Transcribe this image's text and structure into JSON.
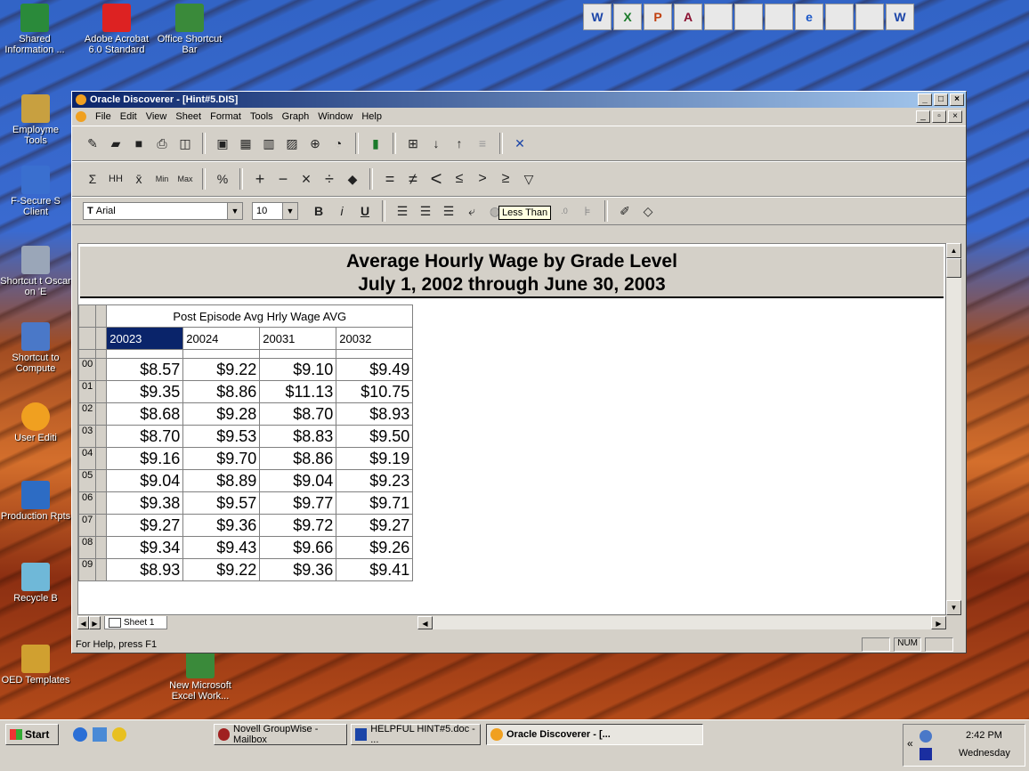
{
  "desktop": {
    "icons": [
      {
        "label": "Shared Information ..."
      },
      {
        "label": "Adobe Acrobat 6.0 Standard"
      },
      {
        "label": "Office Shortcut Bar"
      },
      {
        "label": "Employme Tools"
      },
      {
        "label": "F-Secure S Client"
      },
      {
        "label": "Shortcut t Oscar on 'E"
      },
      {
        "label": "Shortcut to Compute"
      },
      {
        "label": "User Editi"
      },
      {
        "label": "Production Rpts"
      },
      {
        "label": "Recycle B"
      },
      {
        "label": "OED Templates"
      },
      {
        "label": "New Microsoft Excel Work..."
      }
    ],
    "office_bar": [
      "W",
      "X",
      "P",
      "A",
      "",
      "",
      "",
      "e",
      "",
      "",
      "W"
    ]
  },
  "window": {
    "title": "Oracle Discoverer - [Hint#5.DIS]",
    "menu": [
      "File",
      "Edit",
      "View",
      "Sheet",
      "Format",
      "Tools",
      "Graph",
      "Window",
      "Help"
    ],
    "calc_toolbar": {
      "sum": "Σ",
      "count": "HH",
      "avg": "x̄",
      "min": "Min",
      "max": "Max",
      "percent": "%",
      "plus": "+",
      "minus": "−",
      "times": "×",
      "divide": "÷",
      "eq": "=",
      "ne": "≠",
      "lt": "<",
      "le": "≤",
      "gt": ">",
      "ge": "≥"
    },
    "font_name": "Arial",
    "font_size": "10",
    "tooltip": "Less Than",
    "report": {
      "title_line1": "Average Hourly Wage by Grade Level",
      "title_line2": "July 1, 2002 through June 30, 2003",
      "measure_header": "Post Episode Avg Hrly Wage AVG",
      "columns": [
        "20023",
        "20024",
        "20031",
        "20032"
      ],
      "rows": [
        {
          "label": "00",
          "values": [
            "$8.57",
            "$9.22",
            "$9.10",
            "$9.49"
          ]
        },
        {
          "label": "01",
          "values": [
            "$9.35",
            "$8.86",
            "$11.13",
            "$10.75"
          ]
        },
        {
          "label": "02",
          "values": [
            "$8.68",
            "$9.28",
            "$8.70",
            "$8.93"
          ]
        },
        {
          "label": "03",
          "values": [
            "$8.70",
            "$9.53",
            "$8.83",
            "$9.50"
          ]
        },
        {
          "label": "04",
          "values": [
            "$9.16",
            "$9.70",
            "$8.86",
            "$9.19"
          ]
        },
        {
          "label": "05",
          "values": [
            "$9.04",
            "$8.89",
            "$9.04",
            "$9.23"
          ]
        },
        {
          "label": "06",
          "values": [
            "$9.38",
            "$9.57",
            "$9.77",
            "$9.71"
          ]
        },
        {
          "label": "07",
          "values": [
            "$9.27",
            "$9.36",
            "$9.72",
            "$9.27"
          ]
        },
        {
          "label": "08",
          "values": [
            "$9.34",
            "$9.43",
            "$9.66",
            "$9.26"
          ]
        },
        {
          "label": "09",
          "values": [
            "$8.93",
            "$9.22",
            "$9.36",
            "$9.41"
          ]
        }
      ]
    },
    "sheet_tab": "Sheet 1",
    "status_text": "For Help, press F1",
    "status_num": "NUM"
  },
  "taskbar": {
    "start": "Start",
    "tasks": [
      {
        "label": "Novell GroupWise - Mailbox"
      },
      {
        "label": "HELPFUL HINT#5.doc - ..."
      },
      {
        "label": "Oracle Discoverer - [..."
      }
    ],
    "time": "2:42 PM",
    "day": "Wednesday"
  }
}
